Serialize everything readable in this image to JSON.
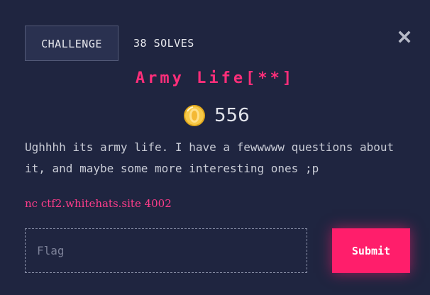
{
  "tabs": {
    "challenge": "CHALLENGE",
    "solves": "38 SOLVES"
  },
  "close_icon": "close-icon",
  "challenge": {
    "title": "Army Life[**]",
    "points": "556",
    "points_icon": "coin-icon",
    "description": "Ughhhh its army life. I have a fewwwww questions about it, and maybe some more interesting ones ;p",
    "connection": "nc ctf2.whitehats.site 4002"
  },
  "form": {
    "flag_placeholder": "Flag",
    "flag_value": "",
    "submit_label": "Submit"
  },
  "colors": {
    "background": "#1f2540",
    "accent": "#ff1e6b",
    "title": "#ff2e7a",
    "text": "#c9ccd6"
  }
}
